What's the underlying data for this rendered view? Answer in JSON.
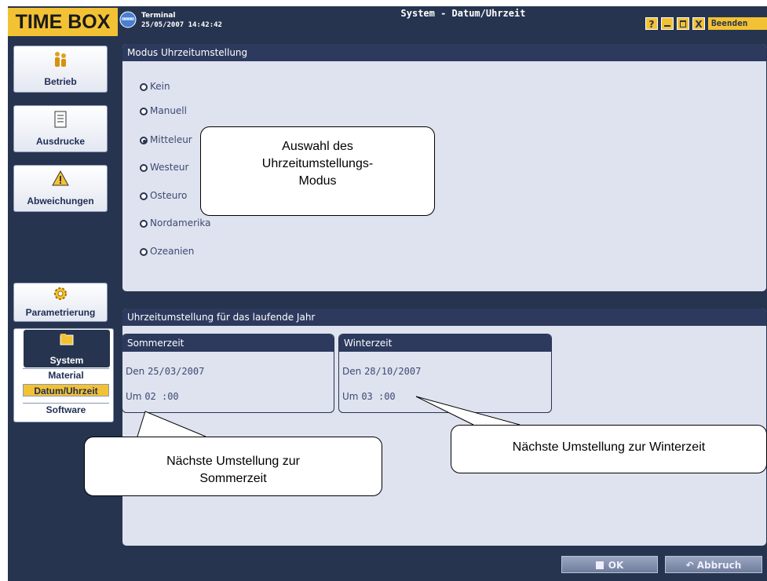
{
  "header": {
    "brand": "TIME BOX",
    "terminal_label": "Terminal",
    "datetime": "25/05/2007 14:42:42",
    "window_title": "System - Datum/Uhrzeit",
    "help": "?",
    "close": "X",
    "quit_label": "Beenden"
  },
  "sidebar": {
    "items": [
      {
        "label": "Betrieb",
        "icon": "operation-icon"
      },
      {
        "label": "Ausdrucke",
        "icon": "document-icon"
      },
      {
        "label": "Abweichungen",
        "icon": "warning-icon"
      },
      {
        "label": "Parametrierung",
        "icon": "gear-icon"
      }
    ],
    "system": {
      "label": "System",
      "icon": "folder-icon",
      "subitems": [
        "Material",
        "Datum/Uhrzeit",
        "Software"
      ],
      "active": "Datum/Uhrzeit"
    }
  },
  "mode_panel": {
    "title": "Modus Uhrzeitumstellung",
    "options": [
      "Kein",
      "Manuell",
      "Mitteleur",
      "Westeur",
      "Osteuro",
      "Nordamerika",
      "Ozeanien"
    ],
    "selected": "Mitteleur"
  },
  "year_panel": {
    "title": "Uhrzeitumstellung für das laufende Jahr",
    "summer": {
      "title": "Sommerzeit",
      "date_label": "Den",
      "date": "25/03/2007",
      "time_label": "Um",
      "time": "02 :00"
    },
    "winter": {
      "title": "Winterzeit",
      "date_label": "Den",
      "date": "28/10/2007",
      "time_label": "Um",
      "time": "03 :00"
    }
  },
  "buttons": {
    "ok": "OK",
    "cancel": "Abbruch"
  },
  "callouts": {
    "modus": [
      "Auswahl des",
      "Uhrzeitumstellungs-",
      "Modus"
    ],
    "sommer": [
      "Nächste Umstellung zur",
      "Sommerzeit"
    ],
    "winter": "Nächste Umstellung zur Winterzeit"
  },
  "colors": {
    "navy": "#26344f",
    "accent": "#f3c234",
    "panel": "#dfe3ef"
  }
}
